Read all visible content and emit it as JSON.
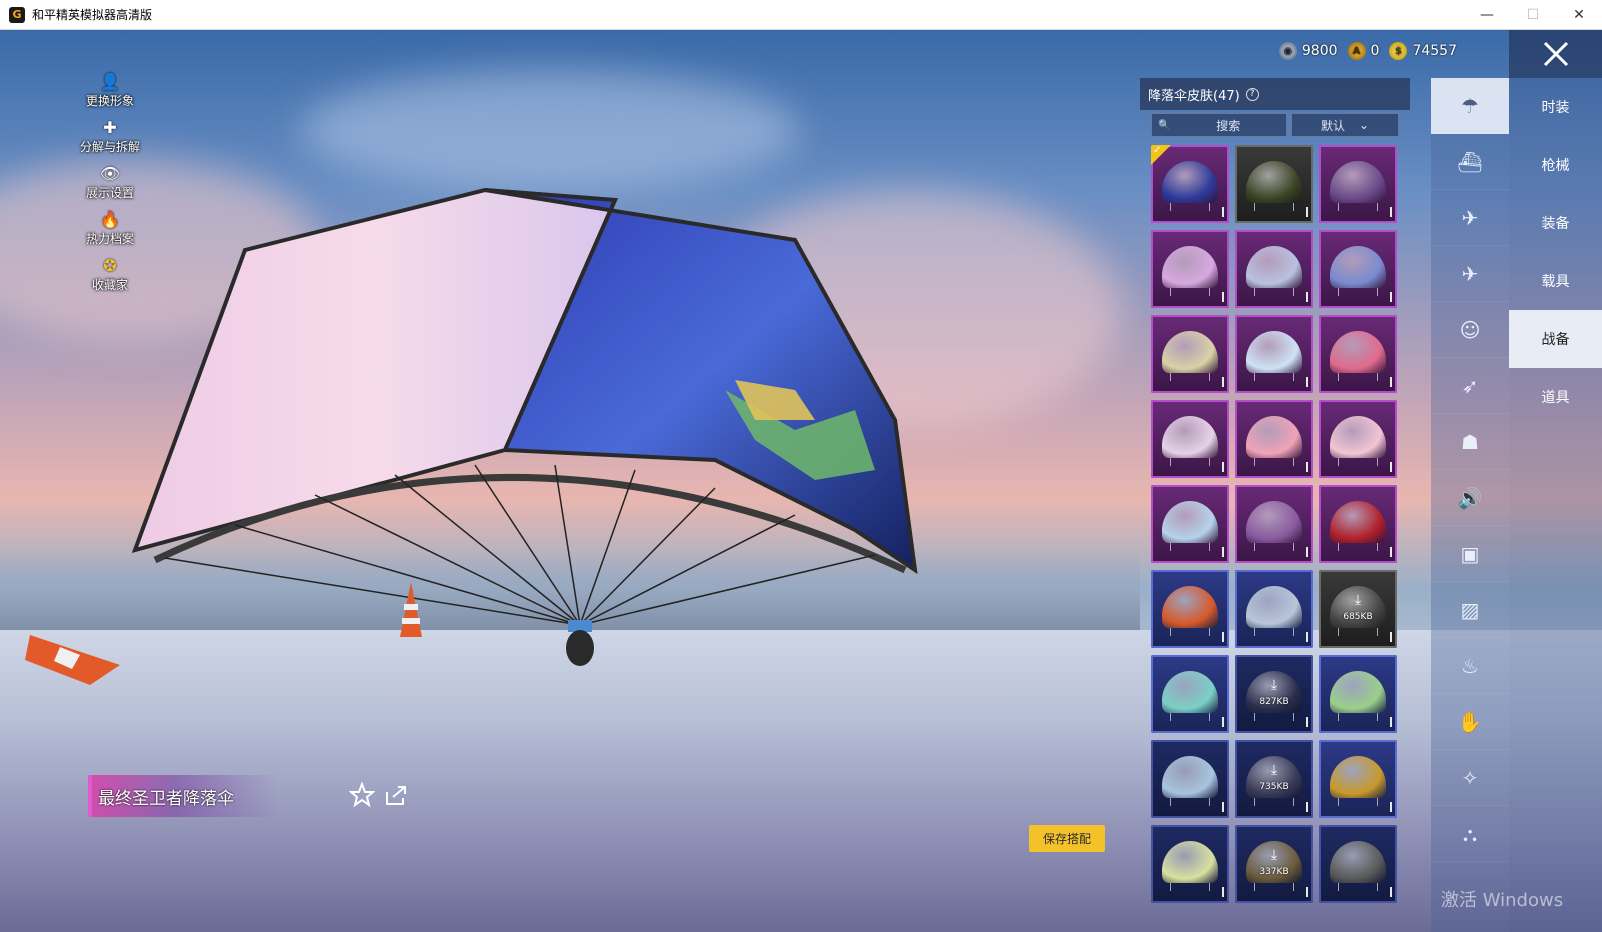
{
  "window": {
    "title": "和平精英模拟器高清版",
    "app_icon": "G",
    "minimize": "—",
    "maximize": "☐",
    "close": "✕"
  },
  "left_menu": [
    {
      "label": "更换形象",
      "icon": "person-icon",
      "glyph": "👤"
    },
    {
      "label": "分解与拆解",
      "icon": "puzzle-icon",
      "glyph": "✚"
    },
    {
      "label": "展示设置",
      "icon": "eye-icon",
      "glyph": "👁"
    },
    {
      "label": "热力档案",
      "icon": "flame-icon",
      "glyph": "🔥"
    },
    {
      "label": "收藏家",
      "icon": "medal-icon",
      "glyph": "✪"
    }
  ],
  "currency": {
    "silver": "9800",
    "coupon": "0",
    "gold": "74557",
    "coupon_letter": "A",
    "gold_letter": "$"
  },
  "right_tabs": {
    "close": "✕",
    "items": [
      "时装",
      "枪械",
      "装备",
      "载具",
      "战备",
      "道具"
    ],
    "active": "战备"
  },
  "icon_column": [
    {
      "name": "parachute-icon",
      "glyph": "☂",
      "active": true
    },
    {
      "name": "glider-icon",
      "glyph": "⛴"
    },
    {
      "name": "drone-icon",
      "glyph": "✈"
    },
    {
      "name": "plane-icon",
      "glyph": "✈"
    },
    {
      "name": "emote-icon",
      "glyph": "☺"
    },
    {
      "name": "wing-icon",
      "glyph": "➶"
    },
    {
      "name": "robot-icon",
      "glyph": "☗"
    },
    {
      "name": "speaker-icon",
      "glyph": "🔊"
    },
    {
      "name": "badge-icon",
      "glyph": "▣"
    },
    {
      "name": "photo-icon",
      "glyph": "▨"
    },
    {
      "name": "spray-icon",
      "glyph": "♨"
    },
    {
      "name": "gesture-icon",
      "glyph": "✋"
    },
    {
      "name": "sparkle-icon",
      "glyph": "✧"
    },
    {
      "name": "landing-icon",
      "glyph": "⛬"
    }
  ],
  "skin_panel": {
    "title": "降落伞皮肤(47)",
    "help": "?",
    "search_placeholder": "搜索",
    "sort_label": "默认",
    "search_icon": "🔍",
    "sort_icon": "⌄"
  },
  "skins": [
    {
      "rarity": "rare-purple",
      "color": "#2c3a9a",
      "equipped": true
    },
    {
      "rarity": "rare-dark",
      "color": "#3b4424"
    },
    {
      "rarity": "rare-purple",
      "color": "#6a4a8a"
    },
    {
      "rarity": "rare-purple",
      "color": "#d7a8e0"
    },
    {
      "rarity": "rare-purple",
      "color": "#b9c2e0"
    },
    {
      "rarity": "rare-purple",
      "color": "#7a8bd0"
    },
    {
      "rarity": "rare-purple",
      "color": "#d9d2a6"
    },
    {
      "rarity": "rare-purple",
      "color": "#cfe2f6"
    },
    {
      "rarity": "rare-purple",
      "color": "#e06a8c"
    },
    {
      "rarity": "rare-purple",
      "color": "#e6d2e8"
    },
    {
      "rarity": "rare-purple",
      "color": "#f0a3b8"
    },
    {
      "rarity": "rare-purple",
      "color": "#f2c6d4"
    },
    {
      "rarity": "rare-purple",
      "color": "#b6d2ea"
    },
    {
      "rarity": "rare-purple",
      "color": "#8a5aa0"
    },
    {
      "rarity": "rare-purple",
      "color": "#b0202a"
    },
    {
      "rarity": "rare-blue",
      "color": "#d65a2a"
    },
    {
      "rarity": "rare-blue",
      "color": "#b8c6d8"
    },
    {
      "rarity": "rare-dark",
      "color": "#444",
      "download": "685KB"
    },
    {
      "rarity": "rare-blue",
      "color": "#7ad0c6"
    },
    {
      "rarity": "rare-navy",
      "color": "#2a2e4a",
      "download": "827KB"
    },
    {
      "rarity": "rare-blue",
      "color": "#9ad08a"
    },
    {
      "rarity": "rare-navy",
      "color": "#a8c4e0"
    },
    {
      "rarity": "rare-navy",
      "color": "#3a3a58",
      "download": "735KB"
    },
    {
      "rarity": "rare-blue",
      "color": "#c89a2a"
    },
    {
      "rarity": "rare-navy",
      "color": "#d8e0a0"
    },
    {
      "rarity": "rare-navy",
      "color": "#6a5a3a",
      "download": "337KB"
    },
    {
      "rarity": "rare-navy",
      "color": "#5a5a5a"
    }
  ],
  "selected_skin": {
    "name": "最终圣卫者降落伞",
    "fav_icon": "☆",
    "share_icon": "⇱"
  },
  "save_button": "保存搭配",
  "watermark": "激活 Windows",
  "colors": {
    "accent_yellow": "#f3c22a",
    "rare_purple": "#b64ccc",
    "tab_active_bg": "#e8edf5"
  }
}
